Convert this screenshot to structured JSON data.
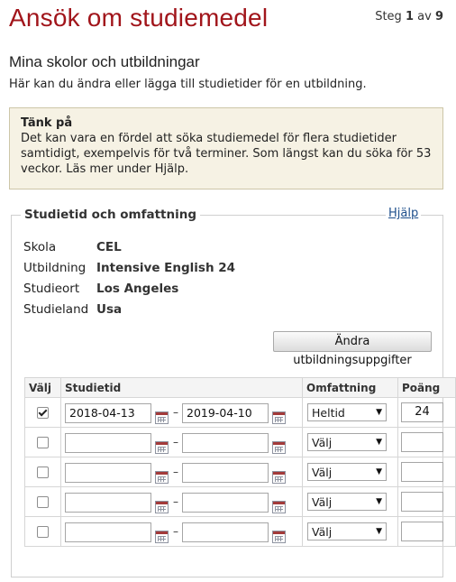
{
  "header": {
    "title": "Ansök om studiemedel",
    "step_prefix": "Steg",
    "step_current": "1",
    "step_of": "av",
    "step_total": "9"
  },
  "section": {
    "title": "Mina skolor och utbildningar",
    "intro": "Här kan du ändra eller lägga till studietider för en utbildning."
  },
  "notice": {
    "title": "Tänk på",
    "text": "Det kan vara en fördel att söka studiemedel för flera studietider samtidigt, exempelvis för två terminer. Som längst kan du söka för 53 veckor. Läs mer under Hjälp."
  },
  "study_box": {
    "legend": "Studietid och omfattning",
    "help_link": "Hjälp",
    "info": [
      {
        "label": "Skola",
        "value": "CEL"
      },
      {
        "label": "Utbildning",
        "value": "Intensive English 24"
      },
      {
        "label": "Studieort",
        "value": "Los Angeles"
      },
      {
        "label": "Studieland",
        "value": "Usa"
      }
    ],
    "change_button": "Ändra utbildningsuppgifter",
    "table": {
      "headers": [
        "Välj",
        "Studietid",
        "Omfattning",
        "Poäng"
      ],
      "rows": [
        {
          "checked": true,
          "from": "2018-04-13",
          "to": "2019-04-10",
          "omfattning": "Heltid",
          "poang": "24"
        },
        {
          "checked": false,
          "from": "",
          "to": "",
          "omfattning": "Välj",
          "poang": ""
        },
        {
          "checked": false,
          "from": "",
          "to": "",
          "omfattning": "Välj",
          "poang": ""
        },
        {
          "checked": false,
          "from": "",
          "to": "",
          "omfattning": "Välj",
          "poang": ""
        },
        {
          "checked": false,
          "from": "",
          "to": "",
          "omfattning": "Välj",
          "poang": ""
        }
      ],
      "dash": "–"
    }
  },
  "colors": {
    "title": "#a1151b",
    "notice_bg": "#f6f2e4",
    "link": "#1e4f8c"
  },
  "icons": {
    "calendar": "calendar-icon",
    "checkmark": "checkbox-check-icon",
    "dropdown": "chevron-down-icon"
  }
}
